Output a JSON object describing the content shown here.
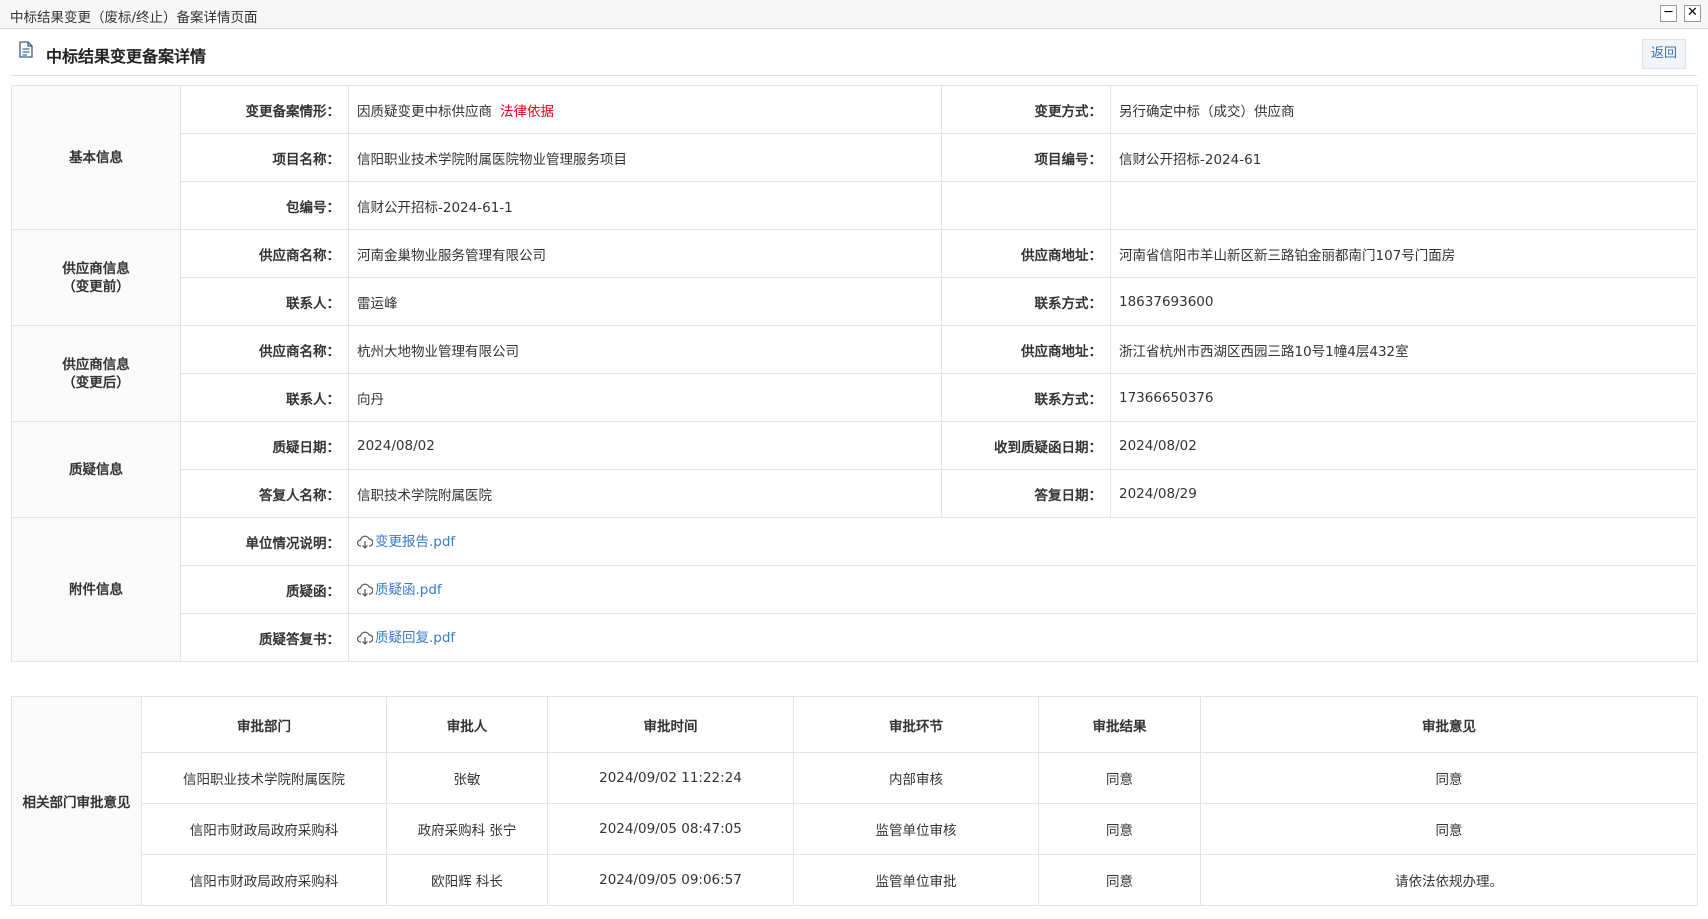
{
  "window": {
    "title": "中标结果变更（废标/终止）备案详情页面",
    "minimize": "─",
    "close": "✕"
  },
  "header": {
    "title": "中标结果变更备案详情",
    "back_label": "返回"
  },
  "basic": {
    "section": "基本信息",
    "change_type_label": "变更备案情形：",
    "change_type_value": "因质疑变更中标供应商",
    "legal_basis": "法律依据",
    "change_method_label": "变更方式：",
    "change_method_value": "另行确定中标（成交）供应商",
    "project_name_label": "项目名称：",
    "project_name_value": "信阳职业技术学院附属医院物业管理服务项目",
    "project_no_label": "项目编号：",
    "project_no_value": "信财公开招标-2024-61",
    "package_no_label": "包编号：",
    "package_no_value": "信财公开招标-2024-61-1"
  },
  "supplier_before": {
    "section_line1": "供应商信息",
    "section_line2": "（变更前）",
    "name_label": "供应商名称：",
    "name_value": "河南金巢物业服务管理有限公司",
    "address_label": "供应商地址：",
    "address_value": "河南省信阳市羊山新区新三路铂金丽都南门107号门面房",
    "contact_label": "联系人：",
    "contact_value": "雷运峰",
    "phone_label": "联系方式：",
    "phone_value": "18637693600"
  },
  "supplier_after": {
    "section_line1": "供应商信息",
    "section_line2": "（变更后）",
    "name_label": "供应商名称：",
    "name_value": "杭州大地物业管理有限公司",
    "address_label": "供应商地址：",
    "address_value": "浙江省杭州市西湖区西园三路10号1幢4层432室",
    "contact_label": "联系人：",
    "contact_value": "向丹",
    "phone_label": "联系方式：",
    "phone_value": "17366650376"
  },
  "challenge": {
    "section": "质疑信息",
    "date_label": "质疑日期：",
    "date_value": "2024/08/02",
    "received_label": "收到质疑函日期：",
    "received_value": "2024/08/02",
    "responder_label": "答复人名称：",
    "responder_value": "信职技术学院附属医院",
    "reply_date_label": "答复日期：",
    "reply_date_value": "2024/08/29"
  },
  "attachments": {
    "section": "附件信息",
    "items": [
      {
        "label": "单位情况说明：",
        "file": "变更报告.pdf"
      },
      {
        "label": "质疑函：",
        "file": "质疑函.pdf"
      },
      {
        "label": "质疑答复书：",
        "file": "质疑回复.pdf"
      }
    ]
  },
  "approval": {
    "section": "相关部门审批意见",
    "headers": [
      "审批部门",
      "审批人",
      "审批时间",
      "审批环节",
      "审批结果",
      "审批意见"
    ],
    "rows": [
      [
        "信阳职业技术学院附属医院",
        "张敏",
        "2024/09/02 11:22:24",
        "内部审核",
        "同意",
        "同意"
      ],
      [
        "信阳市财政局政府采购科",
        "政府采购科 张宁",
        "2024/09/05 08:47:05",
        "监管单位审核",
        "同意",
        "同意"
      ],
      [
        "信阳市财政局政府采购科",
        "欧阳辉 科长",
        "2024/09/05 09:06:57",
        "监管单位审批",
        "同意",
        "请依法依规办理。"
      ]
    ]
  },
  "icons": {
    "document": "document-icon",
    "cloud": "cloud-download-icon"
  }
}
